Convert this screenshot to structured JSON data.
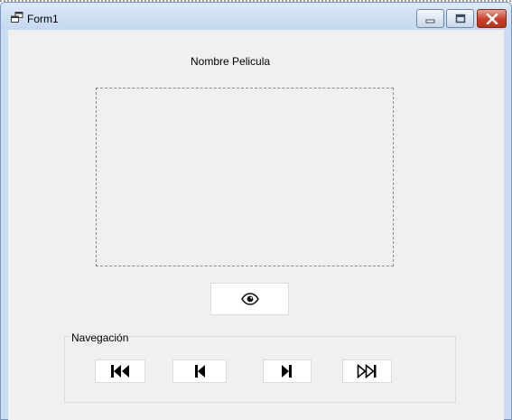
{
  "window": {
    "title": "Form1",
    "icons": {
      "app": "form-window-icon",
      "minimize": "minimize-icon",
      "maximize": "maximize-icon",
      "close": "close-icon"
    },
    "colors": {
      "frame": "#c9dcf2",
      "client": "#f0f0f0",
      "close_button": "#c7402a"
    }
  },
  "form": {
    "movie_name_label": "Nombre Pelicula",
    "view_button_icon": "eye-icon",
    "navigation": {
      "legend": "Navegación",
      "buttons": [
        {
          "name": "first",
          "icon": "skip-to-first-icon"
        },
        {
          "name": "previous",
          "icon": "step-back-icon"
        },
        {
          "name": "next",
          "icon": "step-forward-icon"
        },
        {
          "name": "last",
          "icon": "skip-to-last-icon"
        }
      ]
    }
  }
}
